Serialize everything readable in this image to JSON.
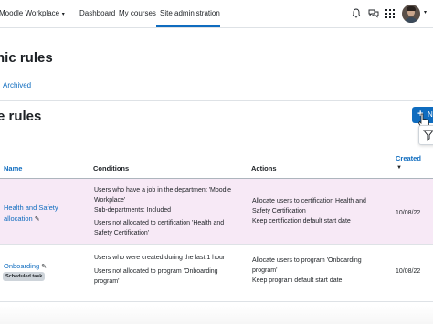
{
  "topbar": {
    "brand": "Moodle Workplace",
    "nav": [
      {
        "label": "Dashboard"
      },
      {
        "label": "My courses"
      },
      {
        "label": "Site administration"
      }
    ]
  },
  "page": {
    "heading": "nic rules",
    "archived_link": "Archived",
    "section_heading": "e rules",
    "new_button_label": "N"
  },
  "table": {
    "headers": {
      "name": "Name",
      "conditions": "Conditions",
      "actions": "Actions",
      "created": "Created"
    },
    "rows": [
      {
        "name_line1": "Health and Safety",
        "name_line2": "allocation",
        "conditions": [
          "Users who have a job in the department 'Moodle",
          "Workplace'",
          "Sub-departments: Included",
          "Users not allocated to certification 'Health and",
          "Safety Certification'"
        ],
        "actions": [
          "Allocate users to certification Health and",
          "Safety Certification",
          "Keep certification default start date"
        ],
        "created": "10/08/22"
      },
      {
        "name_line1": "Onboarding",
        "badge": "Scheduled task",
        "conditions": [
          "Users who were created during the last 1 hour",
          "Users not allocated to program 'Onboarding",
          "program'"
        ],
        "actions": [
          "Allocate users to program 'Onboarding",
          "program'",
          "Keep program default start date"
        ],
        "created": "10/08/22"
      }
    ]
  },
  "colors": {
    "link": "#0f6cbf",
    "primary_button": "#0f6cbf",
    "highlight_row": "#f7e9f6",
    "badge": "#ced4da"
  },
  "icons": [
    "chevron-down-icon",
    "bell-icon",
    "chat-icon",
    "apps-grid-icon",
    "plus-icon",
    "pointer-cursor-icon",
    "filter-icon",
    "pencil-icon",
    "sort-down-icon"
  ]
}
